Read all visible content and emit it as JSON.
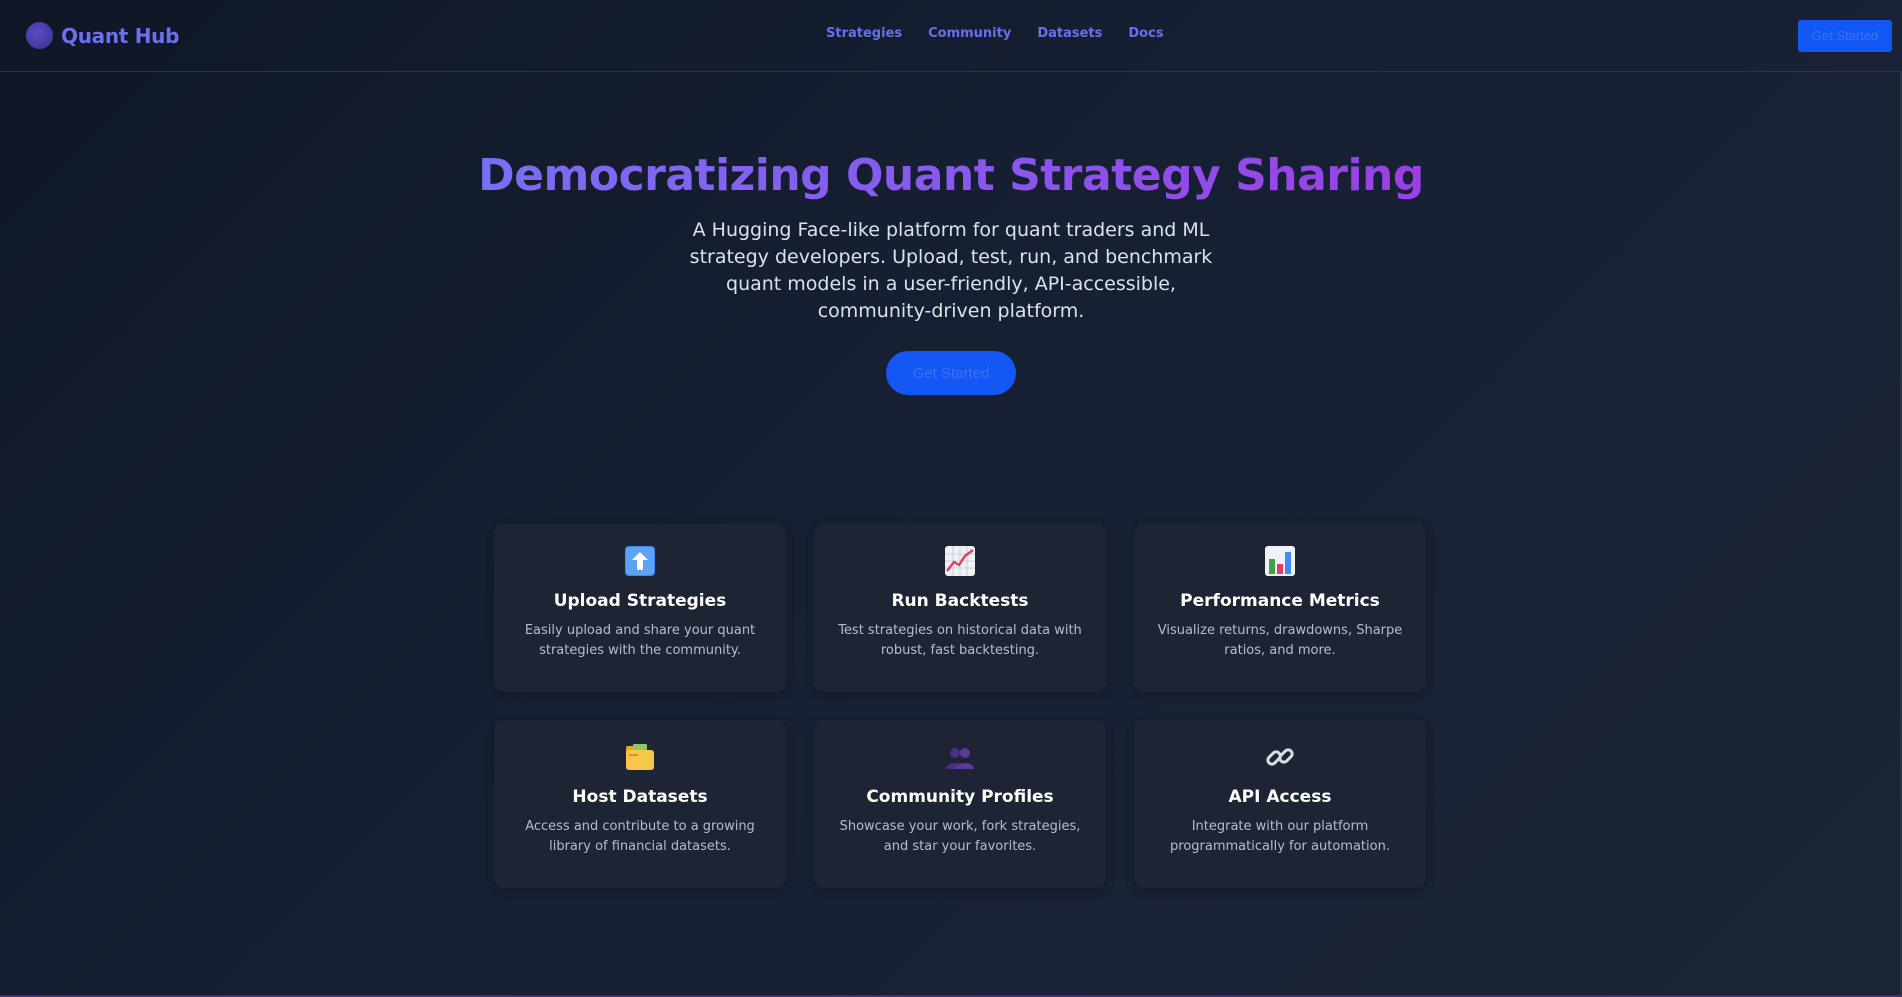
{
  "nav": {
    "brand": "Quant Hub",
    "links": [
      "Strategies",
      "Community",
      "Datasets",
      "Docs"
    ],
    "cta": "Get Started"
  },
  "hero": {
    "title": "Democratizing Quant Strategy Sharing",
    "subtitle": "A Hugging Face-like platform for quant traders and ML strategy developers. Upload, test, run, and benchmark quant models in a user-friendly, API-accessible, community-driven platform.",
    "cta": "Get Started"
  },
  "features": [
    {
      "icon": "upload-arrow-icon",
      "title": "Upload Strategies",
      "desc": "Easily upload and share your quant strategies with the community."
    },
    {
      "icon": "line-chart-icon",
      "title": "Run Backtests",
      "desc": "Test strategies on historical data with robust, fast backtesting."
    },
    {
      "icon": "bar-chart-icon",
      "title": "Performance Metrics",
      "desc": "Visualize returns, drawdowns, Sharpe ratios, and more."
    },
    {
      "icon": "folder-icon",
      "title": "Host Datasets",
      "desc": "Access and contribute to a growing library of financial datasets."
    },
    {
      "icon": "people-icon",
      "title": "Community Profiles",
      "desc": "Showcase your work, fork strategies, and star your favorites."
    },
    {
      "icon": "link-icon",
      "title": "API Access",
      "desc": "Integrate with our platform programmatically for automation."
    }
  ],
  "colors": {
    "accent": "#1357f5",
    "brand": "#6b6ff0",
    "background": "#172033",
    "card": "#1d2535"
  }
}
